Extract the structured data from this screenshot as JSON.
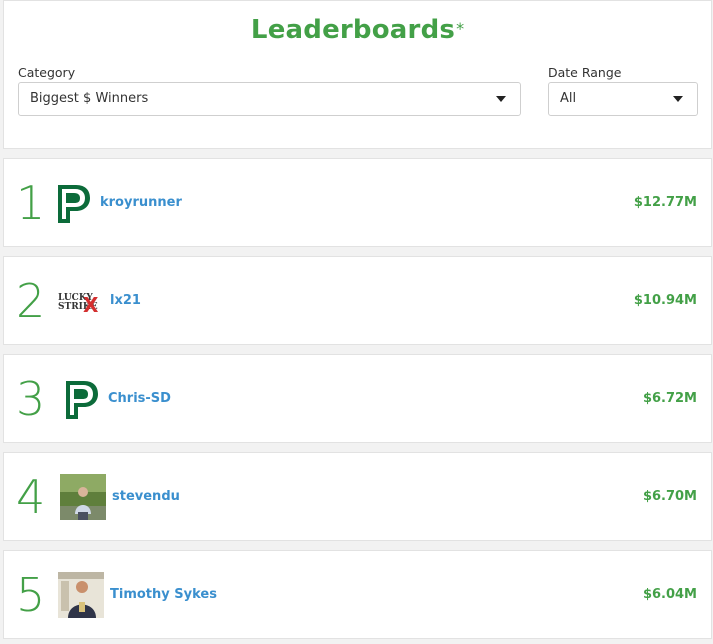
{
  "header": {
    "title": "Leaderboards",
    "asterisk": "*"
  },
  "filters": {
    "category_label": "Category",
    "category_value": "Biggest $ Winners",
    "date_label": "Date Range",
    "date_value": "All"
  },
  "leaders": [
    {
      "rank": "1",
      "username": "kroyrunner",
      "amount": "$12.77M",
      "avatar": "p-logo-icon"
    },
    {
      "rank": "2",
      "username": "lx21",
      "amount": "$10.94M",
      "avatar": "lucky-strike-logo"
    },
    {
      "rank": "3",
      "username": "Chris-SD",
      "amount": "$6.72M",
      "avatar": "p-logo-icon"
    },
    {
      "rank": "4",
      "username": "stevendu",
      "amount": "$6.70M",
      "avatar": "user-photo"
    },
    {
      "rank": "5",
      "username": "Timothy Sykes",
      "amount": "$6.04M",
      "avatar": "user-photo"
    }
  ],
  "colors": {
    "accent_green": "#43a047",
    "link_blue": "#3a8fce"
  }
}
